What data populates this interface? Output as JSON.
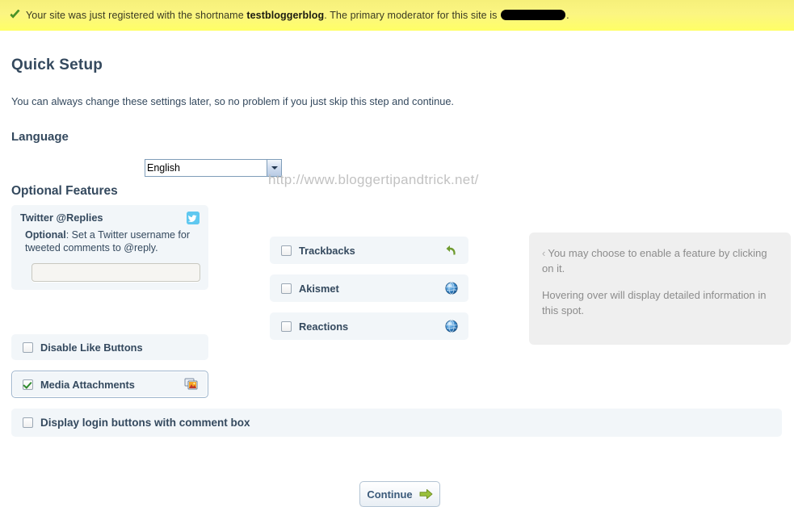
{
  "notice": {
    "icon": "green-check-icon",
    "text_before": "Your site was just registered with the shortname ",
    "shortname": "testbloggerblog",
    "text_middle": ". The primary moderator for this site is ",
    "redacted_value": "",
    "text_after": "."
  },
  "page": {
    "title": "Quick Setup",
    "subtitle": "You can always change these settings later, so no problem if you just skip this step and continue.",
    "watermark": "http://www.bloggertipandtrick.net/"
  },
  "language": {
    "label": "Language",
    "selected": "English",
    "options": [
      "English"
    ]
  },
  "optional_features": {
    "heading": "Optional Features",
    "twitter": {
      "title": "Twitter @Replies",
      "icon": "twitter-bird-icon",
      "desc_bold": "Optional",
      "desc_rest": ": Set a Twitter username for tweeted comments to @reply.",
      "input_value": "",
      "input_placeholder": ""
    },
    "left_column": [
      {
        "label": "Disable Like Buttons",
        "checked": false,
        "selected": false,
        "icon": ""
      },
      {
        "label": "Media Attachments",
        "checked": true,
        "selected": true,
        "icon": "media-attachment-icon"
      }
    ],
    "middle_column": [
      {
        "label": "Trackbacks",
        "checked": false,
        "selected": false,
        "icon": "undo-arrow-icon"
      },
      {
        "label": "Akismet",
        "checked": false,
        "selected": false,
        "icon": "globe-icon"
      },
      {
        "label": "Reactions",
        "checked": false,
        "selected": false,
        "icon": "globe-icon"
      }
    ],
    "full_width_row": {
      "label": "Display login buttons with comment box",
      "checked": false,
      "selected": false
    }
  },
  "info_panel": {
    "chevron": "‹",
    "line1": "You may choose to enable a feature by clicking on it.",
    "line2": "Hovering over will display detailed information in this spot."
  },
  "footer": {
    "continue_label": "Continue",
    "continue_icon": "green-right-arrow-icon"
  },
  "colors": {
    "banner_yellow": "#ffff66",
    "box_bg": "#f2f6f9",
    "info_bg": "#efefef",
    "text": "#34495e",
    "muted": "#8c8c8c",
    "accent_green": "#7fa833"
  }
}
